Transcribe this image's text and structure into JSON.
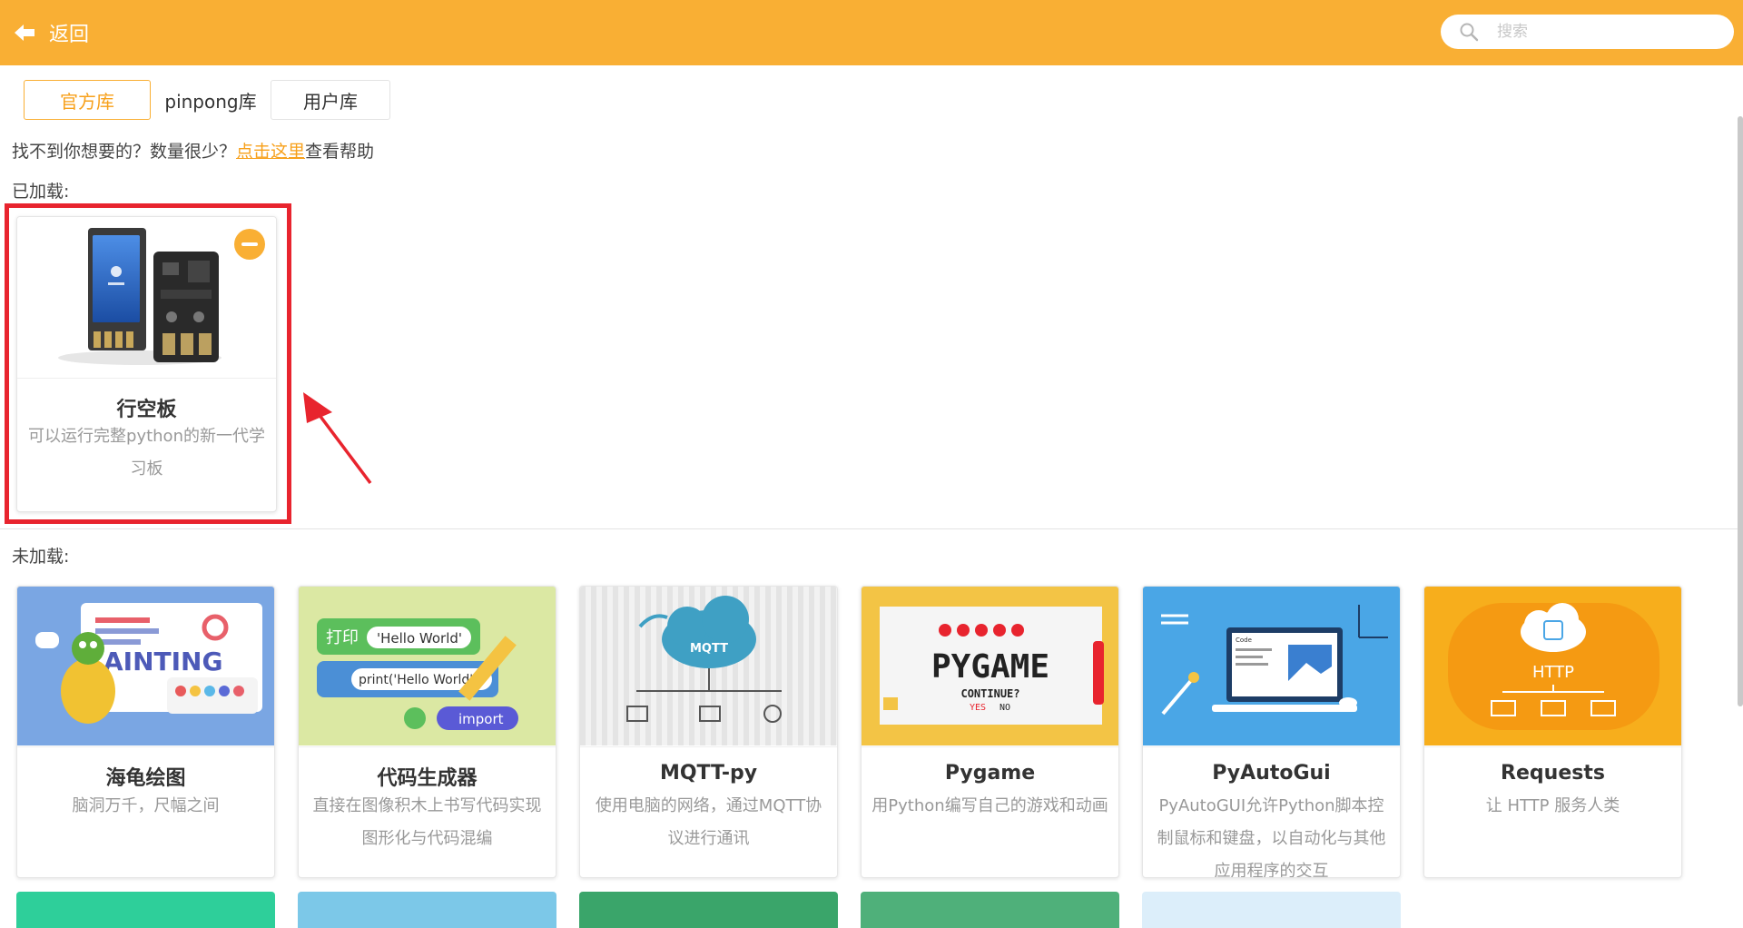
{
  "header": {
    "back_label": "返回",
    "search_placeholder": "搜索",
    "search_value": ""
  },
  "tabs": [
    {
      "label": "官方库",
      "active": true
    },
    {
      "label": "pinpong库",
      "active": false
    },
    {
      "label": "用户库",
      "active": false
    }
  ],
  "help": {
    "prefix": "找不到你想要的？数量很少？",
    "link": "点击这里",
    "suffix": "查看帮助"
  },
  "loaded_section": {
    "label": "已加载:",
    "items": [
      {
        "title": "行空板",
        "desc": "可以运行完整python的新一代学习板"
      }
    ]
  },
  "unloaded_section": {
    "label": "未加载:",
    "items": [
      {
        "title": "海龟绘图",
        "desc": "脑洞万千，尺幅之间",
        "thumb_text": "AINTING"
      },
      {
        "title": "代码生成器",
        "desc": "直接在图像积木上书写代码实现图形化与代码混编",
        "thumb_text_1": "打印",
        "thumb_text_2": "'Hello World'",
        "thumb_text_3": "print('Hello World')",
        "thumb_text_4": "import"
      },
      {
        "title": "MQTT-py",
        "desc": "使用电脑的网络，通过MQTT协议进行通讯",
        "thumb_text": "MQTT"
      },
      {
        "title": "Pygame",
        "desc": "用Python编写自己的游戏和动画",
        "thumb_text_1": "PYGAME",
        "thumb_text_2": "CONTINUE?",
        "thumb_text_3": "YES",
        "thumb_text_4": "NO"
      },
      {
        "title": "PyAutoGui",
        "desc": "PyAutoGUI允许Python脚本控制鼠标和键盘，以自动化与其他应用程序的交互",
        "thumb_text": "Code"
      },
      {
        "title": "Requests",
        "desc": "让 HTTP 服务人类",
        "thumb_text": "HTTP"
      }
    ]
  },
  "colors": {
    "accent": "#f9af34",
    "accent_text": "#f7a01a",
    "highlight": "#e8242e"
  }
}
